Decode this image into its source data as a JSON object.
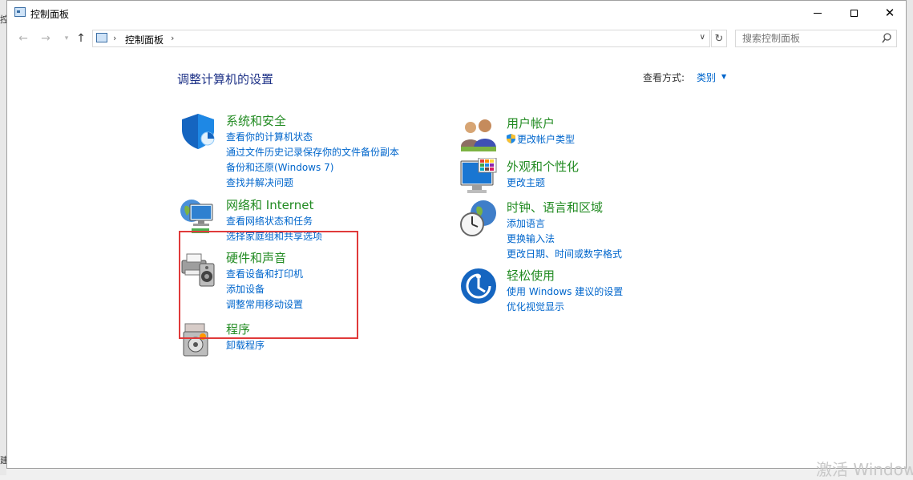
{
  "window": {
    "title": "控制面板",
    "controls": {
      "minimize": "minimize",
      "maximize": "maximize",
      "close": "close"
    }
  },
  "nav": {
    "breadcrumb": "控制面板",
    "search": {
      "placeholder": "搜索控制面板"
    }
  },
  "main": {
    "title": "调整计算机的设置",
    "view_by_label": "查看方式:",
    "view_by_value": "类别",
    "categories": [
      {
        "heading": "系统和安全",
        "icon": "shield-icon",
        "links": [
          "查看你的计算机状态",
          "通过文件历史记录保存你的文件备份副本",
          "备份和还原(Windows 7)",
          "查找并解决问题"
        ]
      },
      {
        "heading": "网络和 Internet",
        "icon": "globe-network-icon",
        "links": [
          "查看网络状态和任务",
          "选择家庭组和共享选项"
        ]
      },
      {
        "heading": "硬件和声音",
        "icon": "printer-speaker-icon",
        "links": [
          "查看设备和打印机",
          "添加设备",
          "调整常用移动设置"
        ]
      },
      {
        "heading": "程序",
        "icon": "programs-icon",
        "links": [
          "卸载程序"
        ]
      },
      {
        "heading": "用户帐户",
        "icon": "users-icon",
        "links": [
          "更改帐户类型"
        ]
      },
      {
        "heading": "外观和个性化",
        "icon": "monitor-icon",
        "links": [
          "更改主题"
        ]
      },
      {
        "heading": "时钟、语言和区域",
        "icon": "clock-globe-icon",
        "links": [
          "添加语言",
          "更换输入法",
          "更改日期、时间或数字格式"
        ]
      },
      {
        "heading": "轻松使用",
        "icon": "ease-of-access-icon",
        "links": [
          "使用 Windows 建议的设置",
          "优化视觉显示"
        ]
      }
    ]
  },
  "watermark": "激活 Window",
  "background": {
    "left_char_top": "控",
    "left_char_bottom": "建"
  },
  "colors": {
    "link": "#0066cc",
    "heading": "#228b22",
    "title": "#1e3287",
    "highlight": "#e03a3a"
  }
}
